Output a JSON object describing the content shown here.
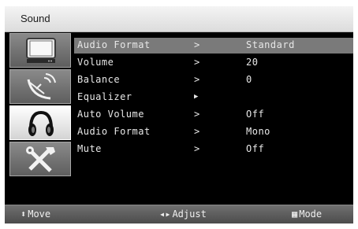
{
  "window": {
    "title": "Sound"
  },
  "sidebar": {
    "items": [
      {
        "icon": "tv-icon",
        "active": false
      },
      {
        "icon": "satellite-dish-icon",
        "active": false
      },
      {
        "icon": "headphones-icon",
        "active": true
      },
      {
        "icon": "tools-icon",
        "active": false
      }
    ]
  },
  "menu": {
    "rows": [
      {
        "label": "Audio Format",
        "arrow": ">",
        "value": "Standard"
      },
      {
        "label": "Volume",
        "arrow": ">",
        "value": "20"
      },
      {
        "label": "Balance",
        "arrow": ">",
        "value": "0"
      },
      {
        "label": "Equalizer",
        "arrow": "▶",
        "value": ""
      },
      {
        "label": "Auto Volume",
        "arrow": ">",
        "value": "Off"
      },
      {
        "label": "Audio Format",
        "arrow": ">",
        "value": "Mono"
      },
      {
        "label": "Mute",
        "arrow": ">",
        "value": "Off"
      }
    ]
  },
  "footer": {
    "move": {
      "glyph": "⬍",
      "label": "Move"
    },
    "adjust": {
      "glyph": "◂▸",
      "label": "Adjust"
    },
    "mode": {
      "glyph": "▦",
      "label": "Mode"
    }
  },
  "colors": {
    "background": "#000000",
    "selected_row": "#7a7a7a",
    "text": "#e8e8e8"
  }
}
